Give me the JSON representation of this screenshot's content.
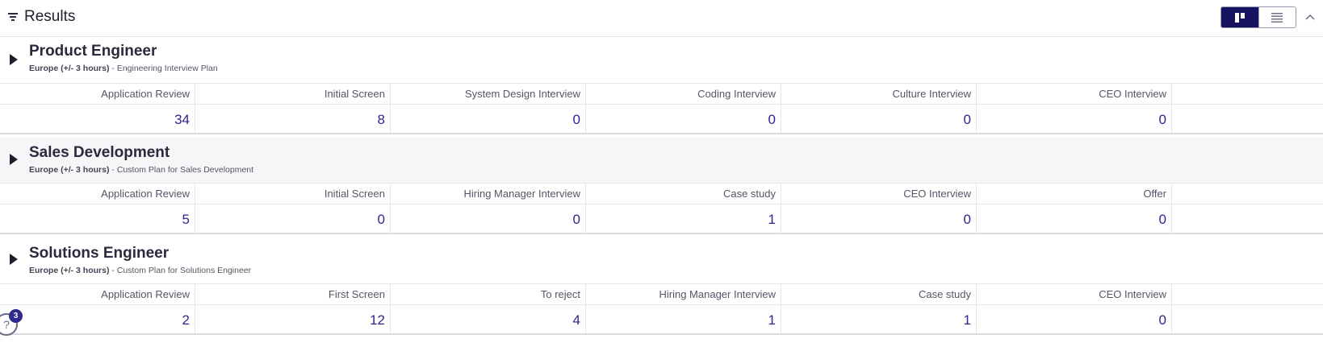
{
  "header": {
    "title": "Results",
    "filter_icon": "filter-icon",
    "view_toggle": {
      "active": "board-view",
      "options": [
        "board-view-icon",
        "list-view-icon"
      ]
    },
    "collapse_icon": "chevron-up-icon"
  },
  "colors": {
    "accent": "#17125f",
    "count_text": "#2d268a",
    "alt_row_bg": "#f6f6f9"
  },
  "sections": [
    {
      "title": "Product Engineer",
      "region": "Europe (+/- 3 hours)",
      "separator": " - ",
      "plan": "Engineering Interview Plan",
      "stages": [
        "Application Review",
        "Initial Screen",
        "System Design Interview",
        "Coding Interview",
        "Culture Interview",
        "CEO Interview"
      ],
      "counts": [
        "34",
        "8",
        "0",
        "0",
        "0",
        "0"
      ]
    },
    {
      "title": "Sales Development",
      "region": "Europe (+/- 3 hours)",
      "separator": " - ",
      "plan": "Custom Plan for Sales Development",
      "stages": [
        "Application Review",
        "Initial Screen",
        "Hiring Manager Interview",
        "Case study",
        "CEO Interview",
        "Offer"
      ],
      "counts": [
        "5",
        "0",
        "0",
        "1",
        "0",
        "0"
      ]
    },
    {
      "title": "Solutions Engineer",
      "region": "Europe (+/- 3 hours)",
      "separator": " - ",
      "plan": "Custom Plan for Solutions Engineer",
      "stages": [
        "Application Review",
        "First Screen",
        "To reject",
        "Hiring Manager Interview",
        "Case study",
        "CEO Interview"
      ],
      "counts": [
        "2",
        "12",
        "4",
        "1",
        "1",
        "0"
      ]
    }
  ],
  "help": {
    "label": "?",
    "badge": "3"
  }
}
